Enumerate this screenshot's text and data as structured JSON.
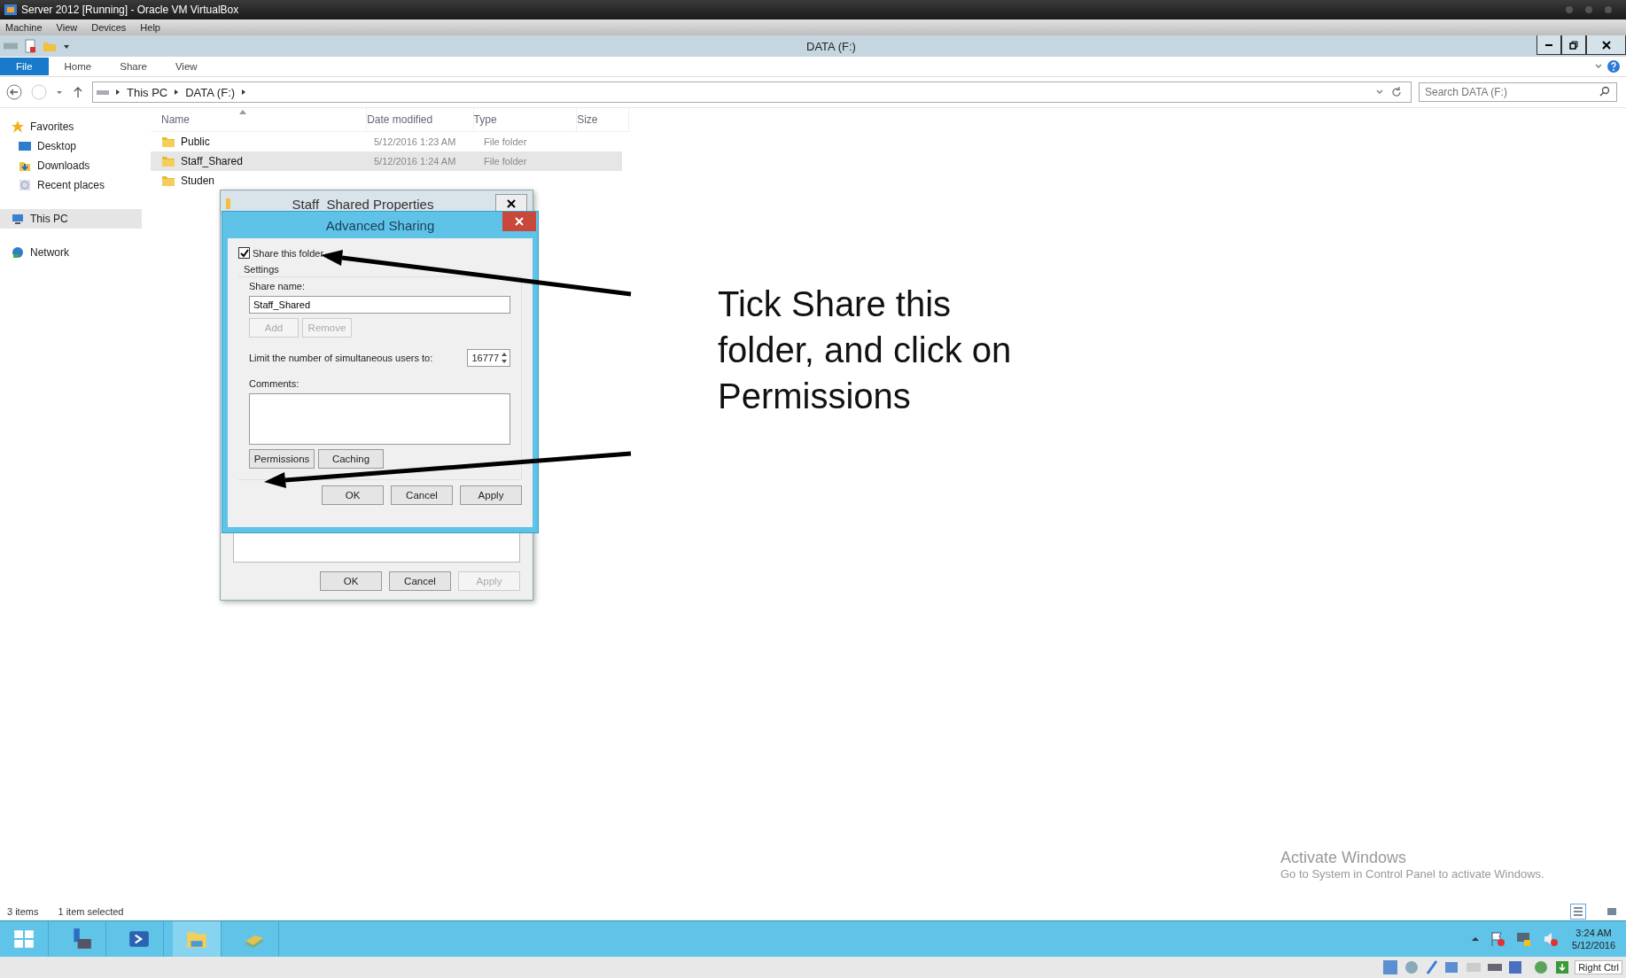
{
  "vbox": {
    "title": "Server 2012 [Running] - Oracle VM VirtualBox",
    "menu": [
      "Machine",
      "View",
      "Devices",
      "Help"
    ],
    "host_key": "Right Ctrl"
  },
  "explorer": {
    "title": "DATA (F:)",
    "ribbon_tabs": [
      {
        "label": "File",
        "selected": true
      },
      {
        "label": "Home",
        "selected": false
      },
      {
        "label": "Share",
        "selected": false
      },
      {
        "label": "View",
        "selected": false
      }
    ],
    "breadcrumb": [
      "This PC",
      "DATA (F:)"
    ],
    "search": {
      "placeholder": "Search DATA (F:)"
    },
    "nav": [
      {
        "label": "Favorites",
        "kind": "star",
        "selected": false,
        "children": [
          {
            "label": "Desktop",
            "kind": "desktop",
            "selected": false
          },
          {
            "label": "Downloads",
            "kind": "download",
            "selected": false
          },
          {
            "label": "Recent places",
            "kind": "recent",
            "selected": false
          }
        ]
      },
      {
        "label": "This PC",
        "kind": "pc",
        "selected": true
      },
      {
        "label": "Network",
        "kind": "network",
        "selected": false
      }
    ],
    "columns": [
      "Name",
      "Date modified",
      "Type",
      "Size"
    ],
    "rows": [
      {
        "name": "Public",
        "date": "5/12/2016 1:23 AM",
        "type": "File folder",
        "selected": false
      },
      {
        "name": "Staff_Shared",
        "date": "5/12/2016 1:24 AM",
        "type": "File folder",
        "selected": true
      },
      {
        "name": "Studen",
        "selected": false
      }
    ],
    "status": [
      "3 items",
      "1 item selected"
    ]
  },
  "properties_dialog": {
    "title": "Staff_Shared Properties",
    "buttons": [
      {
        "label": "OK",
        "disabled": false
      },
      {
        "label": "Cancel",
        "disabled": false
      },
      {
        "label": "Apply",
        "disabled": true
      }
    ]
  },
  "advanced_sharing": {
    "title": "Advanced Sharing",
    "share_folder": {
      "label": "Share this folder",
      "checked": true
    },
    "settings_label": "Settings",
    "share_name_label": "Share name:",
    "share_name": "Staff_Shared",
    "name_buttons": [
      {
        "label": "Add",
        "disabled": true
      },
      {
        "label": "Remove",
        "disabled": true
      }
    ],
    "limit_label": "Limit the number of simultaneous users to:",
    "limit_value": "16777",
    "comments_label": "Comments:",
    "option_buttons": [
      {
        "label": "Permissions",
        "disabled": false
      },
      {
        "label": "Caching",
        "disabled": false
      }
    ],
    "buttons": [
      {
        "label": "OK",
        "disabled": false
      },
      {
        "label": "Cancel",
        "disabled": false
      },
      {
        "label": "Apply",
        "disabled": false
      }
    ]
  },
  "annotation": "Tick Share this folder, and click on Permissions",
  "activation": {
    "title": "Activate Windows",
    "text": "Go to System in Control Panel to activate Windows."
  },
  "clock": {
    "time": "3:24 AM",
    "date": "5/12/2016"
  }
}
